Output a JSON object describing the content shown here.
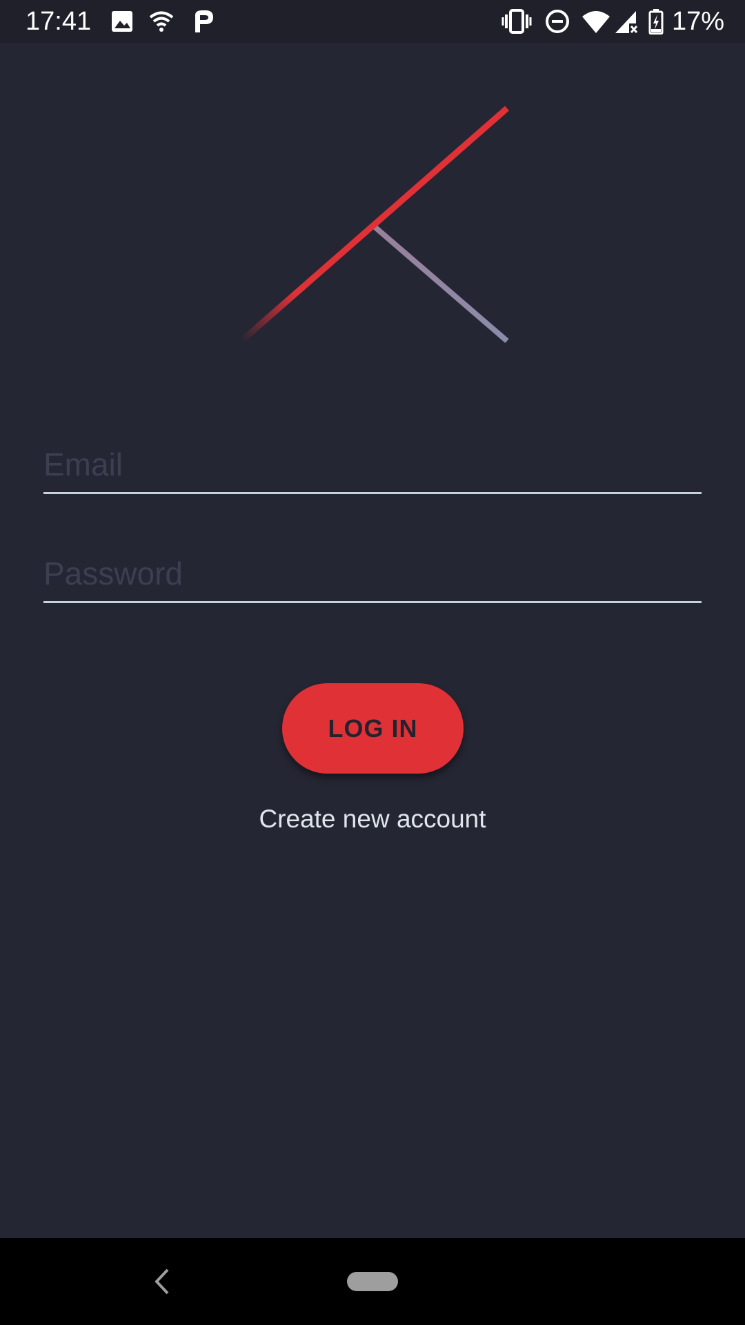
{
  "status_bar": {
    "time": "17:41",
    "battery_percent": "17%",
    "icons": [
      "image-notification-icon",
      "wifi-notification-icon",
      "parking-app-icon",
      "vibrate-icon",
      "do-not-disturb-icon",
      "wifi-signal-icon",
      "cell-signal-no-service-icon",
      "battery-charging-icon"
    ]
  },
  "logo": {
    "icon": "z-hourglass-logo",
    "colors": {
      "red": "#e03137",
      "slate": "#8a8dab"
    }
  },
  "form": {
    "email_placeholder": "Email",
    "email_value": "",
    "password_placeholder": "Password",
    "password_value": "",
    "login_label": "LOG IN",
    "create_account_label": "Create new account"
  },
  "theme": {
    "background": "#252633",
    "accent": "#e03137",
    "underline": "#c5d3dc"
  },
  "nav_bar": {
    "icons": [
      "back-chevron-icon",
      "home-pill-icon"
    ]
  }
}
